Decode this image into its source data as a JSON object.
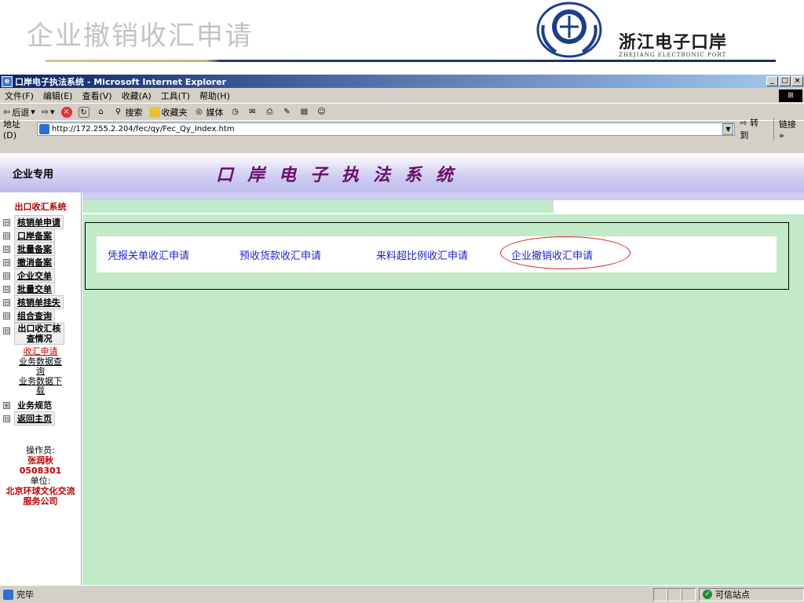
{
  "slide": {
    "title": "企业撤销收汇申请",
    "logo_cn": "浙江电子口岸",
    "logo_en": "ZHEJIANG ELECTRONIC PORT"
  },
  "window": {
    "title": "口岸电子执法系统 - Microsoft Internet Explorer",
    "buttons": [
      "_",
      "□",
      "×"
    ]
  },
  "menubar": {
    "items": [
      "文件(F)",
      "编辑(E)",
      "查看(V)",
      "收藏(A)",
      "工具(T)",
      "帮助(H)"
    ]
  },
  "toolbar": {
    "back": "后退",
    "search": "搜索",
    "favorites": "收藏夹",
    "media": "媒体"
  },
  "addressbar": {
    "label": "地址(D)",
    "url": "http://172.255.2.204/fec/qy/Fec_Qy_Index.htm",
    "go": "转到",
    "links": "链接 »"
  },
  "page": {
    "corp_label": "企业专用",
    "system_title": "口岸电子执法系统"
  },
  "sidebar": {
    "heading": "出口收汇系统",
    "items": [
      {
        "label": "核销单申请",
        "toggle": "⊟"
      },
      {
        "label": "口岸备案",
        "toggle": "⊟"
      },
      {
        "label": "批量备案",
        "toggle": "⊟"
      },
      {
        "label": "撤消备案",
        "toggle": "⊟"
      },
      {
        "label": "企业交单",
        "toggle": "⊟"
      },
      {
        "label": "批量交单",
        "toggle": "⊟"
      },
      {
        "label": "核销单挂失",
        "toggle": "⊟"
      },
      {
        "label": "组合查询",
        "toggle": "⊟"
      }
    ],
    "expanded": {
      "label": "出口收汇核查情况",
      "toggle": "⊟"
    },
    "sub_links": [
      "收汇申请",
      "业务数据查询",
      "业务数据下载"
    ],
    "after_items": [
      {
        "label": "业务规范",
        "toggle": "⊞"
      },
      {
        "label": "返回主页",
        "toggle": "⊟"
      }
    ],
    "operator_label": "操作员:",
    "operator_name": "张润秋",
    "operator_id": "0508301",
    "unit_label": "单位:",
    "unit_name": "北京环球文化交流服务公司"
  },
  "content": {
    "links": [
      "凭报关单收汇申请",
      "预收货款收汇申请",
      "来料超比例收汇申请",
      "企业撤销收汇申请"
    ]
  },
  "status": {
    "text": "完毕",
    "zone": "可信站点"
  }
}
